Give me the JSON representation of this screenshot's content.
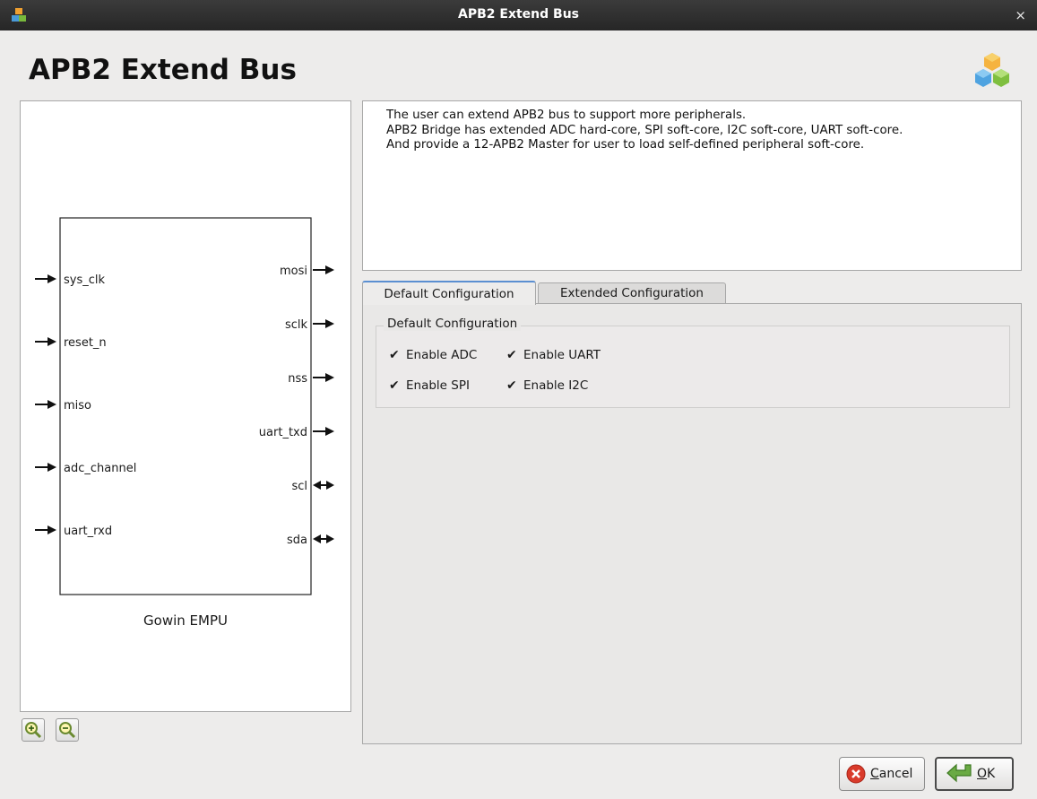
{
  "window": {
    "title": "APB2 Extend Bus",
    "close_glyph": "×",
    "app_icon": "cubes-icon"
  },
  "header": {
    "title": "APB2 Extend Bus",
    "logo_icon": "cubes-icon"
  },
  "preview": {
    "block_label": "Gowin EMPU",
    "inputs": [
      "sys_clk",
      "reset_n",
      "miso",
      "adc_channel",
      "uart_rxd"
    ],
    "outputs": [
      "mosi",
      "sclk",
      "nss",
      "uart_txd",
      "scl",
      "sda"
    ],
    "bidirectional_outputs": [
      "scl",
      "sda"
    ],
    "zoom_in_icon": "zoom-in-icon",
    "zoom_out_icon": "zoom-out-icon"
  },
  "description": {
    "lines": [
      "The user can extend APB2 bus to support more peripherals.",
      "APB2 Bridge has extended ADC hard-core, SPI soft-core, I2C soft-core, UART soft-core.",
      "And provide a 12-APB2 Master for user to load self-defined peripheral soft-core."
    ]
  },
  "tabs": [
    {
      "label": "Default Configuration",
      "active": true
    },
    {
      "label": "Extended Configuration",
      "active": false
    }
  ],
  "default_config": {
    "group_title": "Default Configuration",
    "checkboxes": [
      {
        "label": "Enable ADC",
        "checked": true
      },
      {
        "label": "Enable UART",
        "checked": true
      },
      {
        "label": "Enable SPI",
        "checked": true
      },
      {
        "label": "Enable I2C",
        "checked": true
      }
    ],
    "check_glyph": "✔"
  },
  "buttons": {
    "cancel": {
      "mnemonic": "C",
      "rest": "ancel",
      "icon": "cancel-x-icon"
    },
    "ok": {
      "mnemonic": "O",
      "rest": "K",
      "icon": "enter-arrow-icon"
    }
  },
  "colors": {
    "titlebar": "#2d2d2d",
    "accent": "#5b8fd1",
    "cancel_red": "#d93b2b",
    "ok_green": "#5a9a3a"
  }
}
